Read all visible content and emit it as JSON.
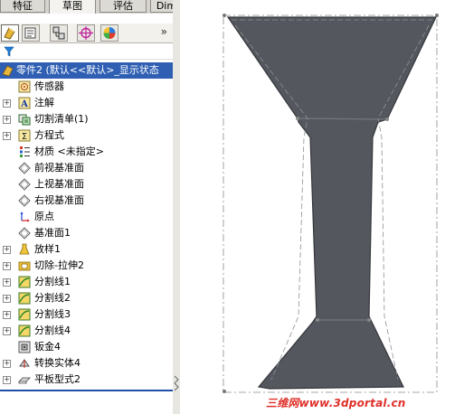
{
  "tabs": [
    {
      "label": "特征",
      "active": false
    },
    {
      "label": "草图",
      "active": true
    },
    {
      "label": "评估",
      "active": false
    },
    {
      "label": "DimXpert",
      "active": false
    }
  ],
  "tree": {
    "root": {
      "label": "零件2  (默认<<默认>_显示状态"
    },
    "items": [
      {
        "label": "传感器",
        "icon": "sensor-icon",
        "expandable": false
      },
      {
        "label": "注解",
        "icon": "annotation-icon",
        "expandable": true
      },
      {
        "label": "切割清单(1)",
        "icon": "cut-list-icon",
        "expandable": true
      },
      {
        "label": "方程式",
        "icon": "equation-icon",
        "expandable": true
      },
      {
        "label": "材质 <未指定>",
        "icon": "material-icon",
        "expandable": false
      },
      {
        "label": "前视基准面",
        "icon": "plane-icon",
        "expandable": false
      },
      {
        "label": "上视基准面",
        "icon": "plane-icon",
        "expandable": false
      },
      {
        "label": "右视基准面",
        "icon": "plane-icon",
        "expandable": false
      },
      {
        "label": "原点",
        "icon": "origin-icon",
        "expandable": false
      },
      {
        "label": "基准面1",
        "icon": "plane-icon",
        "expandable": false
      },
      {
        "label": "放样1",
        "icon": "loft-icon",
        "expandable": true
      },
      {
        "label": "切除-拉伸2",
        "icon": "cut-extrude-icon",
        "expandable": true
      },
      {
        "label": "分割线1",
        "icon": "split-line-icon",
        "expandable": true
      },
      {
        "label": "分割线2",
        "icon": "split-line-icon",
        "expandable": true
      },
      {
        "label": "分割线3",
        "icon": "split-line-icon",
        "expandable": true
      },
      {
        "label": "分割线4",
        "icon": "split-line-icon",
        "expandable": true
      },
      {
        "label": "钣金4",
        "icon": "sheet-metal-icon",
        "expandable": false
      },
      {
        "label": "转换实体4",
        "icon": "convert-entity-icon",
        "expandable": true
      },
      {
        "label": "平板型式2",
        "icon": "flat-pattern-icon",
        "expandable": true
      }
    ]
  },
  "watermark": "三维网www.3dportal.cn",
  "colors": {
    "selection": "#2f5fb3",
    "part": "#54575e",
    "watermark": "#e0302a"
  }
}
